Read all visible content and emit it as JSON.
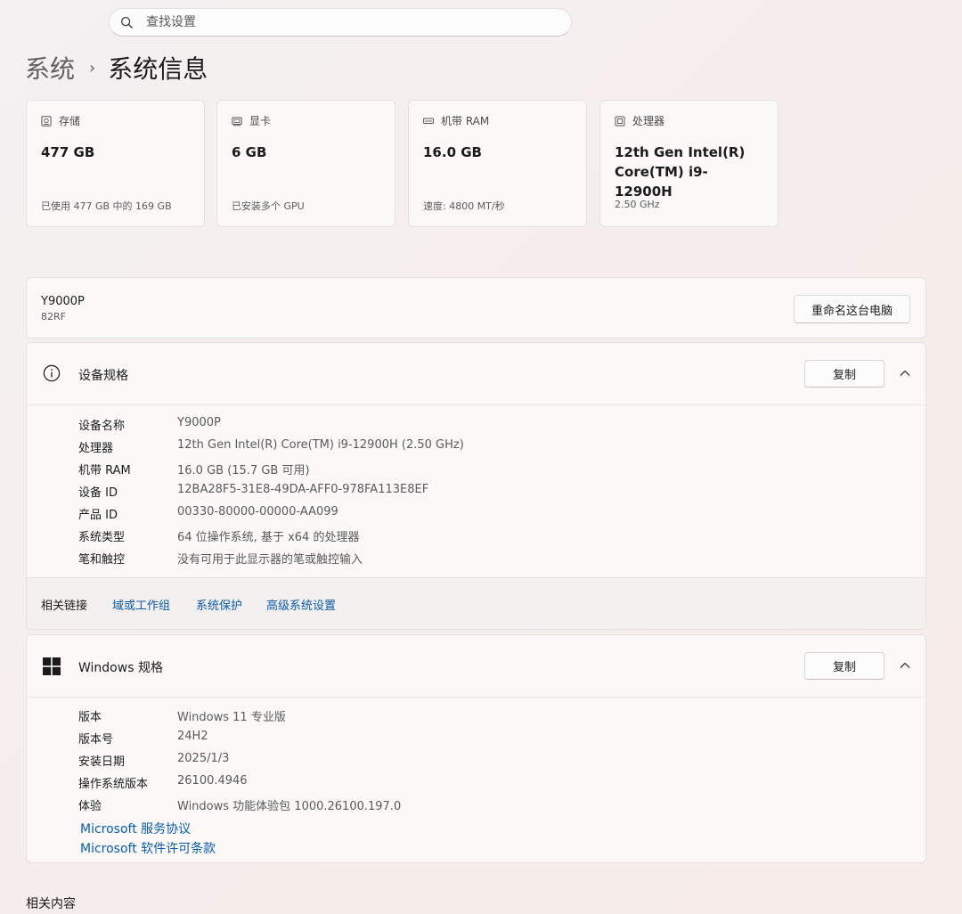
{
  "search": {
    "placeholder": "查找设置"
  },
  "breadcrumb": {
    "parent": "系统",
    "current": "系统信息"
  },
  "cards": [
    {
      "label": "存储",
      "value": "477 GB",
      "sub": "已使用 477 GB 中的 169 GB"
    },
    {
      "label": "显卡",
      "value": "6 GB",
      "sub": "已安装多个 GPU"
    },
    {
      "label": "机带 RAM",
      "value": "16.0 GB",
      "sub": "速度: 4800 MT/秒"
    },
    {
      "label": "处理器",
      "value_line1": "12th Gen Intel(R)",
      "value_line2": "Core(TM) i9-12900H",
      "sub": "2.50 GHz"
    }
  ],
  "pc": {
    "name": "Y9000P",
    "model": "82RF",
    "rename_label": "重命名这台电脑"
  },
  "device_specs": {
    "title": "设备规格",
    "copy_label": "复制",
    "rows": [
      {
        "k": "设备名称",
        "v": "Y9000P"
      },
      {
        "k": "处理器",
        "v": "12th Gen Intel(R) Core(TM) i9-12900H (2.50 GHz)"
      },
      {
        "k": "机带 RAM",
        "v": "16.0 GB (15.7 GB 可用)"
      },
      {
        "k": "设备 ID",
        "v": "12BA28F5-31E8-49DA-AFF0-978FA113E8EF"
      },
      {
        "k": "产品 ID",
        "v": "00330-80000-00000-AA099"
      },
      {
        "k": "系统类型",
        "v": "64 位操作系统, 基于 x64 的处理器"
      },
      {
        "k": "笔和触控",
        "v": "没有可用于此显示器的笔或触控输入"
      }
    ]
  },
  "related_links": {
    "label": "相关链接",
    "links": [
      "域或工作组",
      "系统保护",
      "高级系统设置"
    ]
  },
  "windows_specs": {
    "title": "Windows 规格",
    "copy_label": "复制",
    "rows": [
      {
        "k": "版本",
        "v": "Windows 11 专业版"
      },
      {
        "k": "版本号",
        "v": "24H2"
      },
      {
        "k": "安装日期",
        "v": "2025/1/3"
      },
      {
        "k": "操作系统版本",
        "v": "26100.4946"
      },
      {
        "k": "体验",
        "v": "Windows 功能体验包 1000.26100.197.0"
      }
    ],
    "links": [
      "Microsoft 服务协议",
      "Microsoft 软件许可条款"
    ]
  },
  "related_content": {
    "label": "相关内容"
  }
}
